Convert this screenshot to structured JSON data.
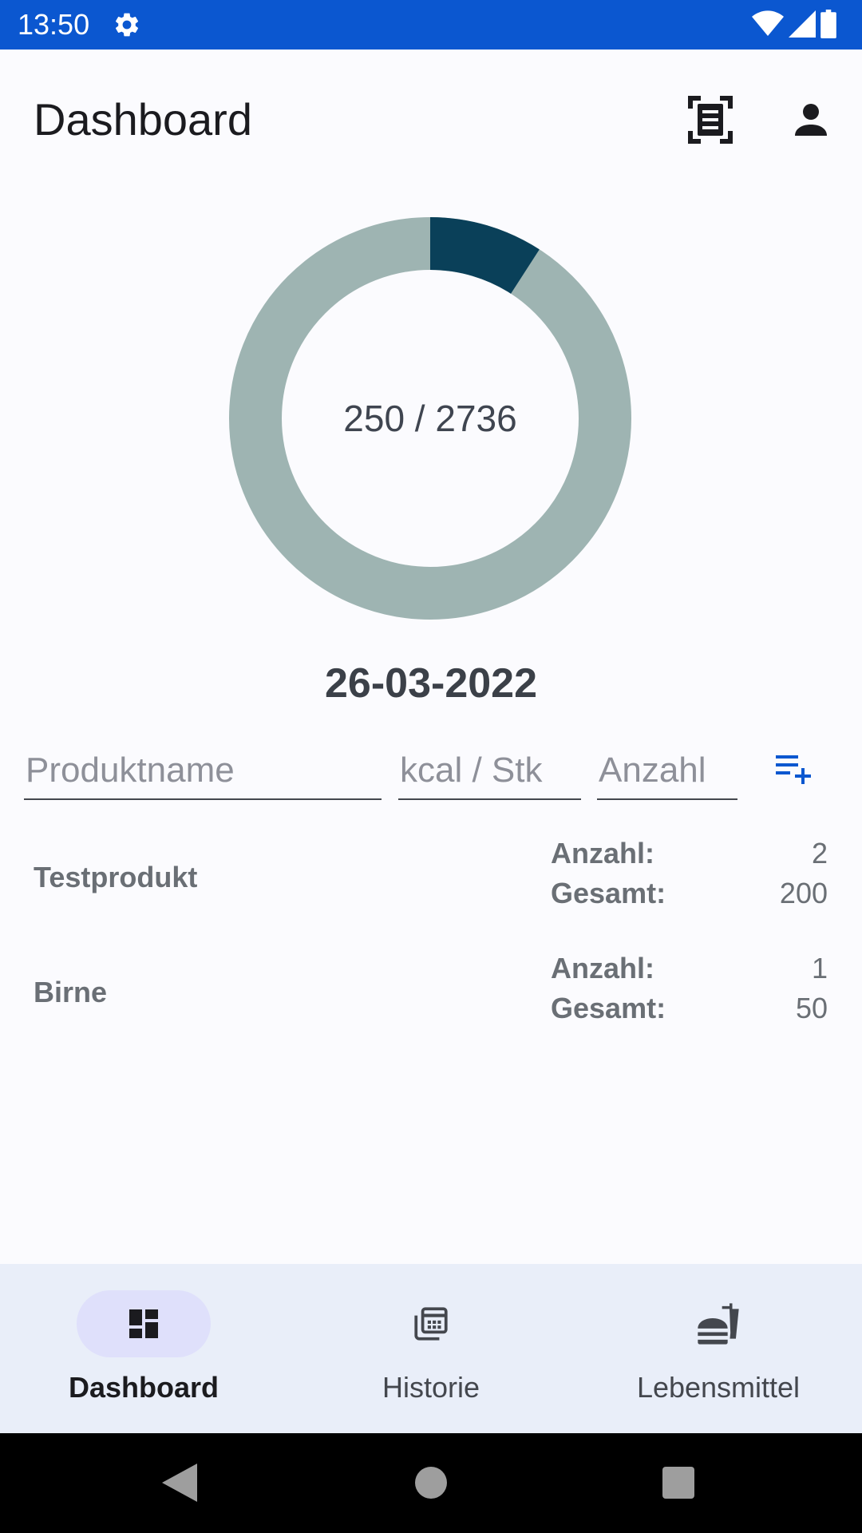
{
  "status_bar": {
    "time": "13:50",
    "icons": [
      "gear-icon",
      "wifi-icon",
      "signal-icon",
      "battery-icon"
    ],
    "background": "#0b57d0"
  },
  "app_bar": {
    "title": "Dashboard",
    "actions": [
      "scan-document-icon",
      "account-icon"
    ]
  },
  "calories": {
    "consumed": 250,
    "goal": 2736,
    "label": "250 / 2736",
    "colors": {
      "consumed": "#0a4059",
      "remaining": "#9eb4b2"
    }
  },
  "date": "26-03-2022",
  "entry_form": {
    "product_placeholder": "Produktname",
    "kcal_placeholder": "kcal / Stk",
    "count_placeholder": "Anzahl",
    "add_icon": "playlist-add-icon",
    "accent": "#0b57d0"
  },
  "entries": [
    {
      "name": "Testprodukt",
      "count_label": "Anzahl:",
      "count": "2",
      "total_label": "Gesamt:",
      "total": "200"
    },
    {
      "name": "Birne",
      "count_label": "Anzahl:",
      "count": "1",
      "total_label": "Gesamt:",
      "total": "50"
    }
  ],
  "bottom_nav": {
    "items": [
      {
        "label": "Dashboard",
        "icon": "dashboard-icon",
        "active": true
      },
      {
        "label": "Historie",
        "icon": "history-calendar-icon",
        "active": false
      },
      {
        "label": "Lebensmittel",
        "icon": "fastfood-icon",
        "active": false
      }
    ]
  },
  "system_nav": [
    "back-icon",
    "home-icon",
    "recents-icon"
  ]
}
